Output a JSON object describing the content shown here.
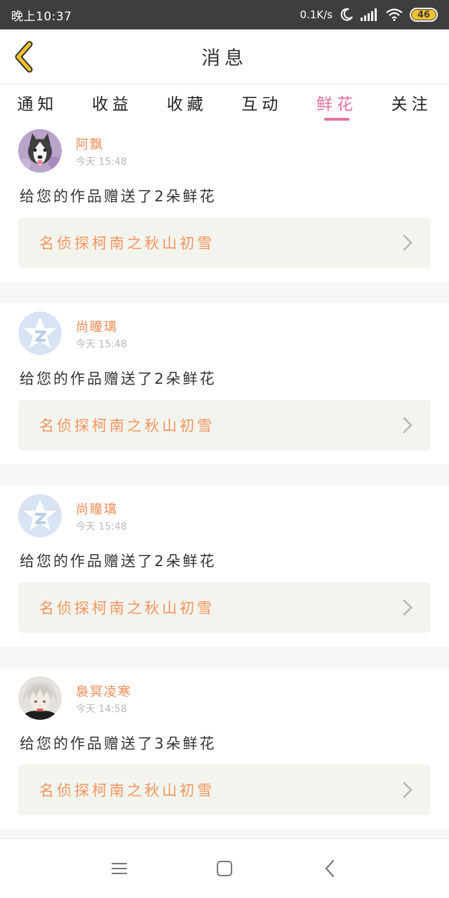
{
  "status_bar": {
    "time": "晚上10:37",
    "network_speed": "0.1K/s",
    "battery": "46"
  },
  "header": {
    "title": "消息"
  },
  "tabs": [
    {
      "label": "通知",
      "active": false
    },
    {
      "label": "收益",
      "active": false
    },
    {
      "label": "收藏",
      "active": false
    },
    {
      "label": "互动",
      "active": false
    },
    {
      "label": "鲜花",
      "active": true
    },
    {
      "label": "关注",
      "active": false
    }
  ],
  "notifications": [
    {
      "username": "阿飘",
      "time": "今天 15:48",
      "message": "给您的作品赠送了2朵鲜花",
      "work_title": "名侦探柯南之秋山初雪",
      "avatar": "husky-dog-avatar"
    },
    {
      "username": "尚瞳璃",
      "time": "今天 15:48",
      "message": "给您的作品赠送了2朵鲜花",
      "work_title": "名侦探柯南之秋山初雪",
      "avatar": "default-star-avatar"
    },
    {
      "username": "尚瞳璃",
      "time": "今天 15:48",
      "message": "给您的作品赠送了2朵鲜花",
      "work_title": "名侦探柯南之秋山初雪",
      "avatar": "default-star-avatar"
    },
    {
      "username": "裊冥凌寒",
      "time": "今天 14:58",
      "message": "给您的作品赠送了3朵鲜花",
      "work_title": "名侦探柯南之秋山初雪",
      "avatar": "anime-boy-avatar"
    }
  ],
  "colors": {
    "accent": "#e46f9d",
    "username": "#f08a55",
    "work_title": "#f3955e",
    "back_arrow": "#f4c22c"
  }
}
